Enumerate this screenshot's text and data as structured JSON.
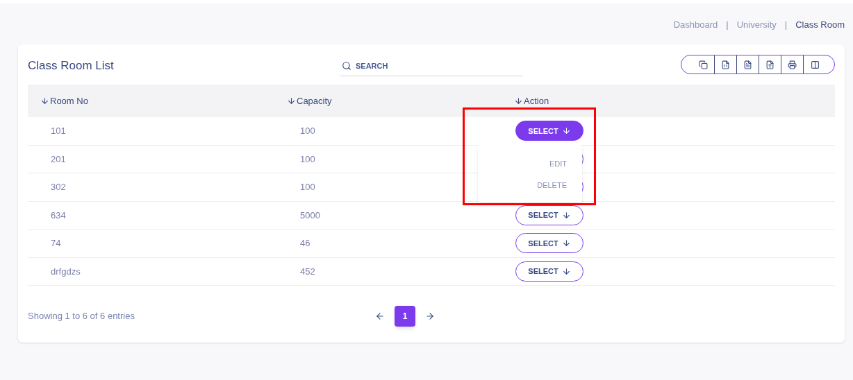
{
  "breadcrumb_separator": "|",
  "breadcrumb": [
    {
      "label": "Dashboard",
      "current": false
    },
    {
      "label": "University",
      "current": false
    },
    {
      "label": "Class Room",
      "current": true
    }
  ],
  "card": {
    "title": "Class Room List",
    "search": {
      "placeholder": "SEARCH"
    }
  },
  "table": {
    "columns": [
      "Room No",
      "Capacity",
      "Action"
    ],
    "rows": [
      {
        "room": "101",
        "capacity": "100",
        "action": "SELECT",
        "open": true
      },
      {
        "room": "201",
        "capacity": "100",
        "open": false
      },
      {
        "room": "302",
        "capacity": "100",
        "open": false
      },
      {
        "room": "634",
        "capacity": "5000",
        "action": "SELECT",
        "open": false
      },
      {
        "room": "74",
        "capacity": "46",
        "action": "SELECT",
        "open": false
      },
      {
        "room": "drfgdzs",
        "capacity": "452",
        "action": "SELECT",
        "open": false
      }
    ]
  },
  "dropdown": {
    "items": [
      "EDIT",
      "DELETE"
    ]
  },
  "footer": {
    "info": "Showing 1 to 6 of 6 entries",
    "pages": [
      {
        "label": "1",
        "selected": true
      }
    ]
  }
}
